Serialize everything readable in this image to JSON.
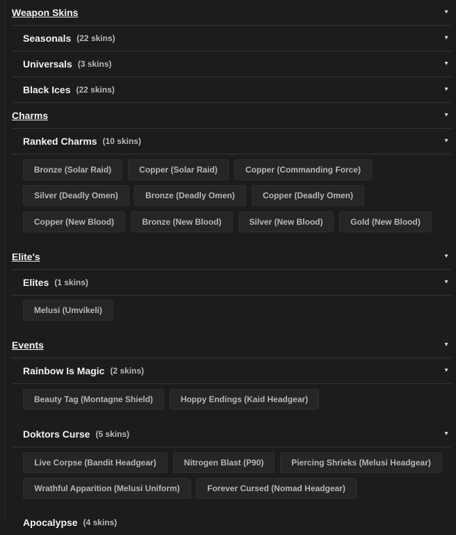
{
  "icons": {
    "expand": "chevron-down-icon"
  },
  "caret_glyph": "▼",
  "sections": {
    "weapon_skins": {
      "title": "Weapon Skins",
      "subs": [
        {
          "title": "Seasonals",
          "count": "(22 skins)"
        },
        {
          "title": "Universals",
          "count": "(3 skins)"
        },
        {
          "title": "Black Ices",
          "count": "(22 skins)"
        }
      ]
    },
    "charms": {
      "title": "Charms",
      "subs": [
        {
          "title": "Ranked Charms",
          "count": "(10 skins)",
          "items": [
            "Bronze (Solar Raid)",
            "Copper (Solar Raid)",
            "Copper (Commanding Force)",
            "Silver (Deadly Omen)",
            "Bronze (Deadly Omen)",
            "Copper (Deadly Omen)",
            "Copper (New Blood)",
            "Bronze (New Blood)",
            "Silver (New Blood)",
            "Gold (New Blood)"
          ]
        }
      ]
    },
    "elites": {
      "title": "Elite's",
      "subs": [
        {
          "title": "Elites",
          "count": "(1 skins)",
          "items": [
            "Melusi (Umvikeli)"
          ]
        }
      ]
    },
    "events": {
      "title": "Events",
      "subs": [
        {
          "title": "Rainbow Is Magic",
          "count": "(2 skins)",
          "items": [
            "Beauty Tag (Montagne Shield)",
            "Hoppy Endings (Kaid Headgear)"
          ]
        },
        {
          "title": "Doktors Curse",
          "count": "(5 skins)",
          "items": [
            "Live Corpse (Bandit Headgear)",
            "Nitrogen Blast (P90)",
            "Piercing Shrieks (Melusi Headgear)",
            "Wrathful Apparition (Melusi Uniform)",
            "Forever Cursed (Nomad Headgear)"
          ]
        },
        {
          "title": "Apocalypse",
          "count": "(4 skins)"
        }
      ]
    }
  }
}
